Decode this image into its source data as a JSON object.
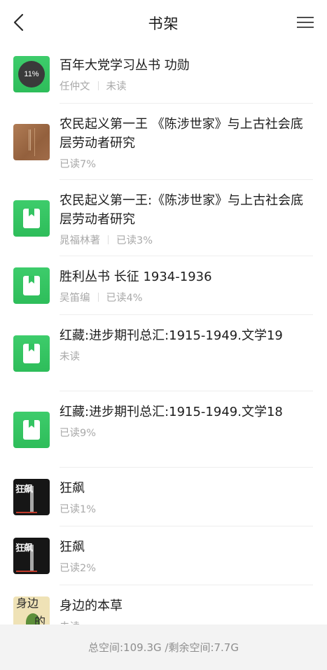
{
  "header": {
    "title": "书架"
  },
  "books": [
    {
      "title": "百年大党学习丛书 功勋",
      "author": "任仲文",
      "status": "未读",
      "progress_label": "11%"
    },
    {
      "title": "农民起义第一王 《陈涉世家》与上古社会底层劳动者研究",
      "author": "",
      "status": "已读7%"
    },
    {
      "title": "农民起义第一王:《陈涉世家》与上古社会底层劳动者研究",
      "author": "晁福林著",
      "status": "已读3%"
    },
    {
      "title": "胜利丛书 长征 1934-1936",
      "author": "吴笛编",
      "status": "已读4%"
    },
    {
      "title": "红藏:进步期刊总汇:1915-1949.文学19",
      "author": "",
      "status": "未读"
    },
    {
      "title": "红藏:进步期刊总汇:1915-1949.文学18",
      "author": "",
      "status": "已读9%"
    },
    {
      "title": "狂飙",
      "author": "",
      "status": "已读1%",
      "cover_text": "狂飙"
    },
    {
      "title": "狂飙",
      "author": "",
      "status": "已读2%",
      "cover_text": "狂飙"
    },
    {
      "title": "身边的本草",
      "author": "",
      "status": "未读",
      "cover_text_1": "身边",
      "cover_text_2": "的"
    }
  ],
  "footer": {
    "storage": "总空间:109.3G /剩余空间:7.7G"
  },
  "colors": {
    "accent": "#34c462",
    "text": "#1d1d1d",
    "muted": "#a9a9a9",
    "footer_bg": "#f3f3f3"
  },
  "icons": {
    "back": "chevron-left-icon",
    "menu": "hamburger-menu-icon",
    "book": "book-icon"
  }
}
